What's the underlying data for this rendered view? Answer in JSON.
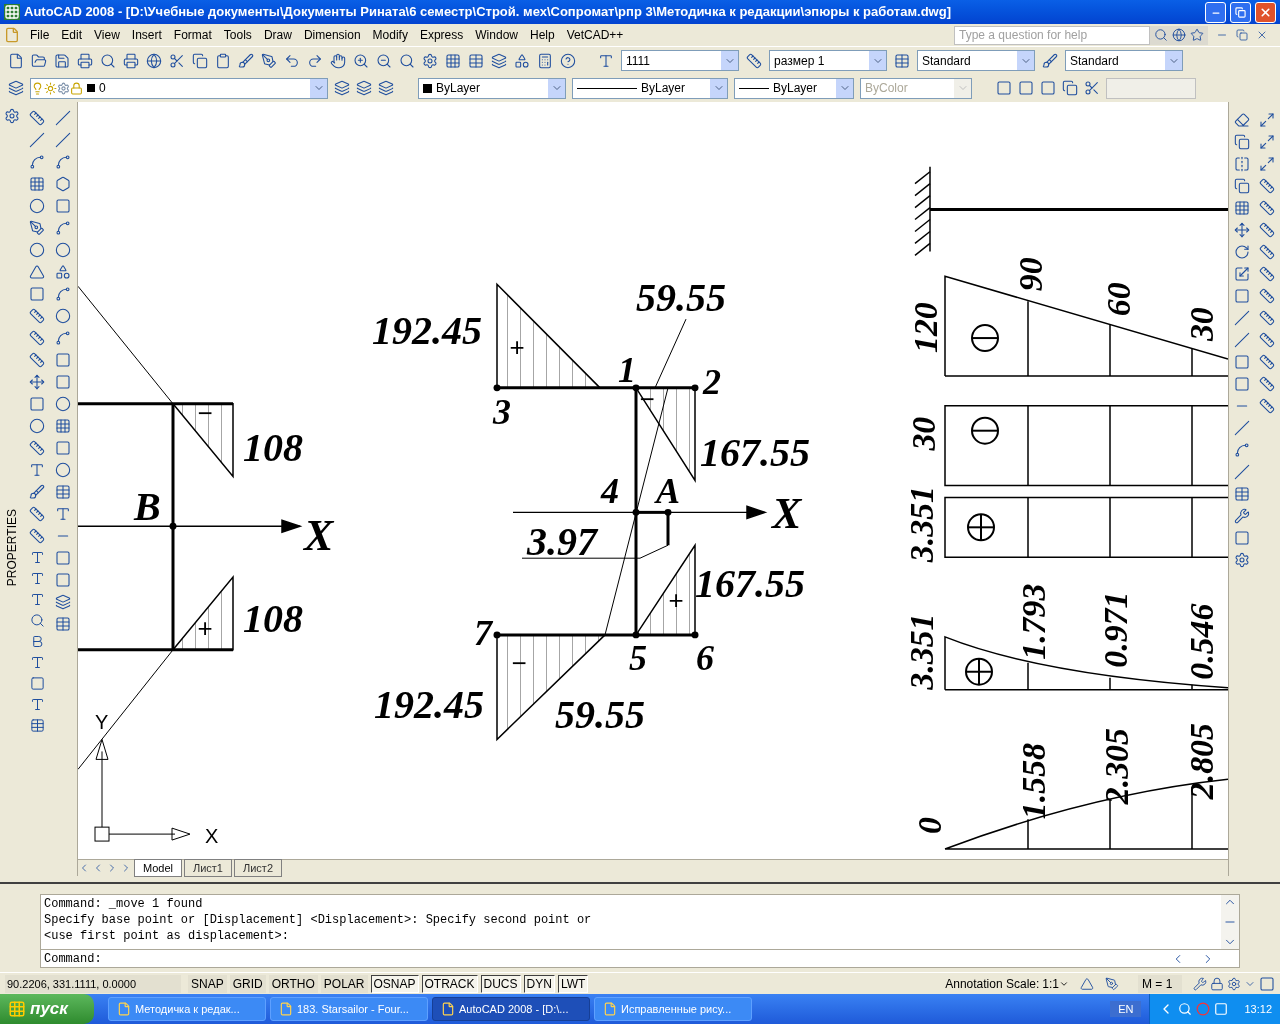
{
  "window": {
    "title": "AutoCAD 2008 - [D:\\Учебные документы\\Документы Рината\\6 семестр\\Строй. мех\\Сопромат\\рпр 3\\Методичка к редакции\\эпюры к работам.dwg]"
  },
  "menu": [
    "File",
    "Edit",
    "View",
    "Insert",
    "Format",
    "Tools",
    "Draw",
    "Dimension",
    "Modify",
    "Express",
    "Window",
    "Help",
    "VetCAD++"
  ],
  "help_search": {
    "placeholder": "Type a question for help"
  },
  "styles_toolbar": {
    "text_style": "1111",
    "dim_style": "размер 1",
    "table_style": "Standard",
    "multileader_style": "Standard"
  },
  "layers_toolbar": {
    "layer": "0"
  },
  "properties_toolbar": {
    "color_value": "ByLayer",
    "linetype": "ByLayer",
    "lineweight": "ByLayer",
    "plot_style": {
      "value": "ByColor",
      "disabled": true
    }
  },
  "properties_palette_label": "PROPERTIES",
  "drawing": {
    "left_labels": [
      "B",
      "X",
      "108",
      "108"
    ],
    "left_signs": [
      "−",
      "+"
    ],
    "middle_labels": [
      "192.45",
      "59.55",
      "1",
      "2",
      "3",
      "167.55",
      "4",
      "A",
      "X",
      "3.97",
      "167.55",
      "7",
      "5",
      "6",
      "192.45",
      "59.55"
    ],
    "middle_signs": [
      "+",
      "−",
      "+",
      "−"
    ],
    "right_labels": [
      "120",
      "90",
      "60",
      "30",
      "30",
      "3.351",
      "3.351",
      "1.793",
      "0.971",
      "0.546",
      "0",
      "1.558",
      "2.305",
      "2.805"
    ],
    "ucs_labels": [
      "Y",
      "X"
    ]
  },
  "layout_tabs": [
    {
      "label": "Model",
      "selected": true
    },
    {
      "label": "Лист1",
      "selected": false
    },
    {
      "label": "Лист2",
      "selected": false
    }
  ],
  "command_history": [
    "Command: _move 1 found",
    "Specify base point or [Displacement] <Displacement>: Specify second point or",
    "<use first point as displacement>:"
  ],
  "command_prompt": "Command:",
  "status": {
    "coordinates": "90.2206, 331.1111, 0.0000",
    "toggles": [
      {
        "label": "SNAP",
        "on": false
      },
      {
        "label": "GRID",
        "on": false
      },
      {
        "label": "ORTHO",
        "on": false
      },
      {
        "label": "POLAR",
        "on": false
      },
      {
        "label": "OSNAP",
        "on": true
      },
      {
        "label": "OTRACK",
        "on": true
      },
      {
        "label": "DUCS",
        "on": true
      },
      {
        "label": "DYN",
        "on": true
      },
      {
        "label": "LWT",
        "on": true
      }
    ],
    "annotation_scale_label": "Annotation Scale:",
    "annotation_scale": "1:1",
    "model_scale": "M = 1"
  },
  "taskbar": {
    "start": "пуск",
    "tasks": [
      {
        "label": "Методичка к редак...",
        "selected": false
      },
      {
        "label": "183. Starsailor - Four...",
        "selected": false
      },
      {
        "label": "AutoCAD 2008 - [D:\\...",
        "selected": true
      },
      {
        "label": "Исправленные рису...",
        "selected": false
      }
    ],
    "language": "EN",
    "clock": "13:12"
  }
}
